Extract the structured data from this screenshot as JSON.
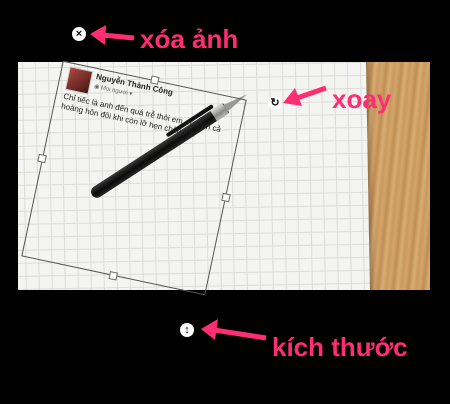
{
  "post": {
    "author": "Nguyễn Thành Công",
    "audience": "Mọi người",
    "text": "Chỉ tiếc là anh đến quá trễ thôi em ơi. Đến cả hoàng hôn đôi khi còn lỡ hẹn chân trời"
  },
  "controls": {
    "delete_icon": "×",
    "rotate_icon": "↻",
    "resize_icon": "↕"
  },
  "annotations": {
    "delete": "xóa ảnh",
    "rotate": "xoay",
    "resize": "kích thước"
  },
  "colors": {
    "annotation": "#ff2d73",
    "background": "#000000"
  }
}
